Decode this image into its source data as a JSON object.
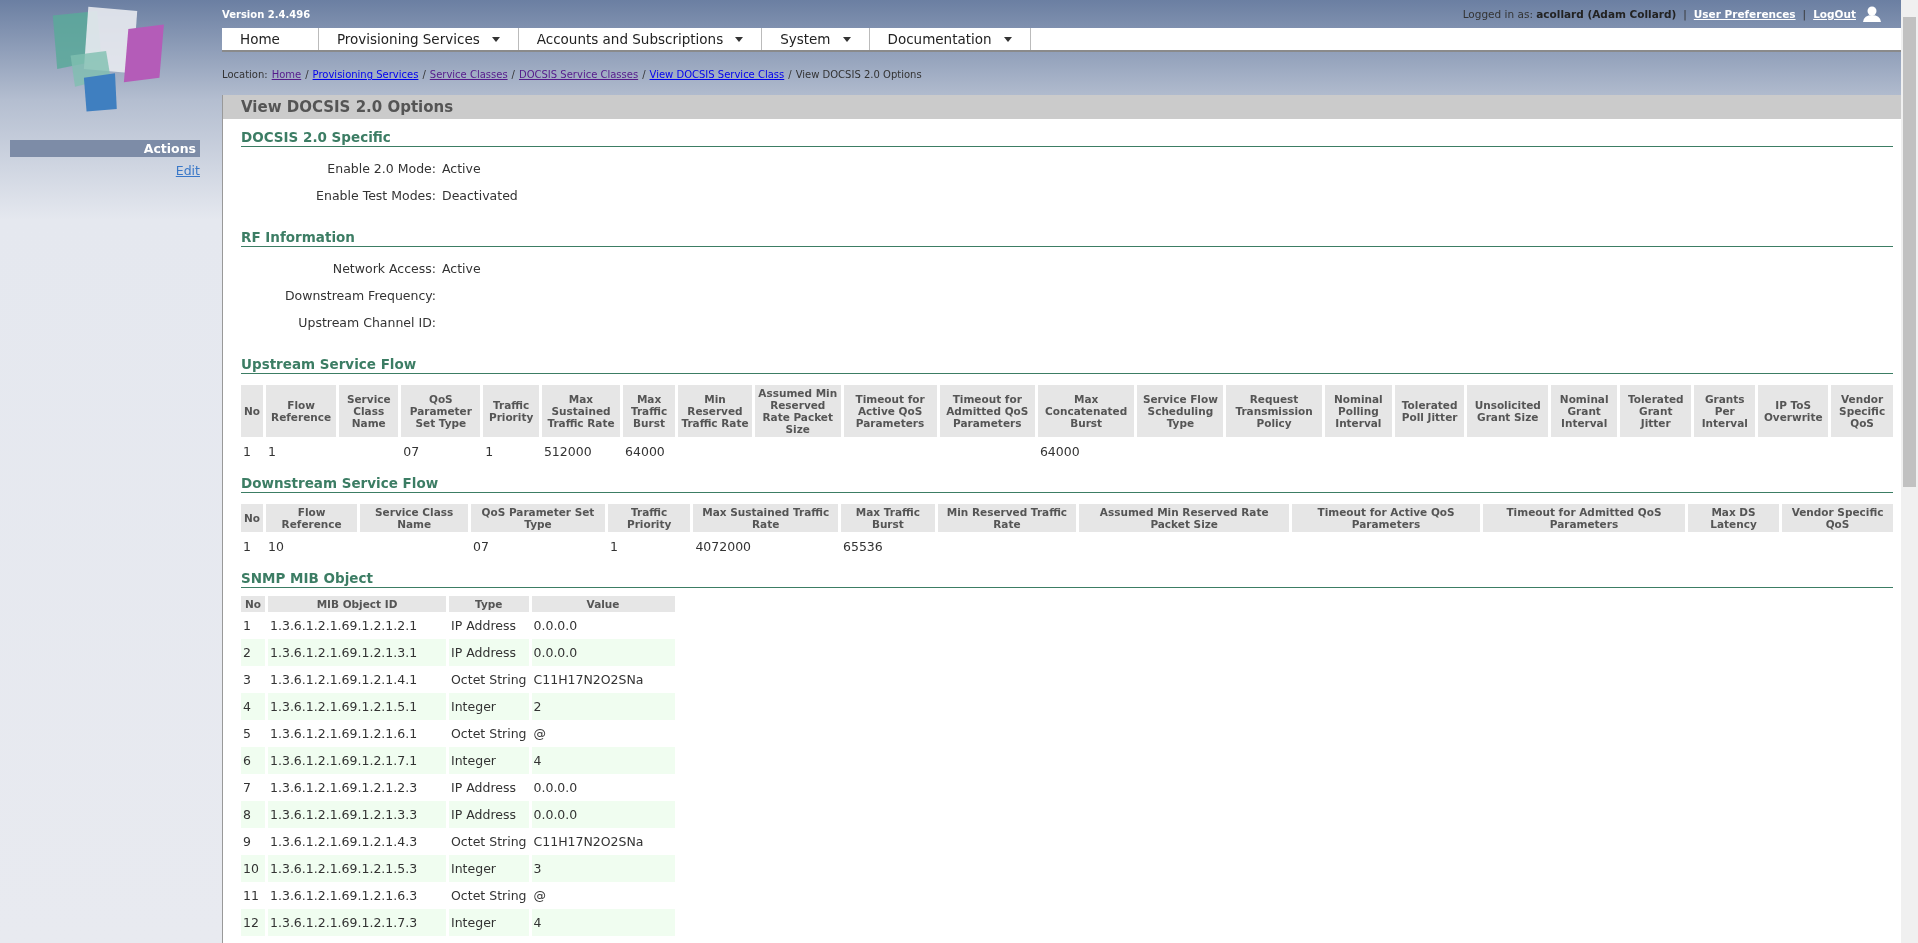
{
  "version": "Version 2.4.496",
  "user": {
    "prefix": "Logged in as:",
    "name": "acollard (Adam Collard)",
    "links": [
      "User Preferences",
      "LogOut"
    ],
    "separator": "|"
  },
  "nav": [
    {
      "label": "Home",
      "dropdown": false
    },
    {
      "label": "Provisioning Services",
      "dropdown": true
    },
    {
      "label": "Accounts and Subscriptions",
      "dropdown": true
    },
    {
      "label": "System",
      "dropdown": true
    },
    {
      "label": "Documentation",
      "dropdown": true
    }
  ],
  "breadcrumb": {
    "label": "Location:",
    "links": [
      {
        "label": "Home",
        "visited": true
      },
      {
        "label": "Provisioning Services",
        "visited": false
      },
      {
        "label": "Service Classes",
        "visited": true
      },
      {
        "label": "DOCSIS Service Classes",
        "visited": true
      },
      {
        "label": "View DOCSIS Service Class",
        "visited": false
      }
    ],
    "current": "View DOCSIS 2.0 Options",
    "separator": "/"
  },
  "sidebar": {
    "title": "Actions",
    "links": [
      "Edit"
    ]
  },
  "page_title": "View DOCSIS 2.0 Options",
  "sections": [
    {
      "title": "DOCSIS 2.0 Specific",
      "kind": "fields",
      "fields": [
        {
          "label": "Enable 2.0 Mode:",
          "value": "Active"
        },
        {
          "label": "Enable Test Modes:",
          "value": "Deactivated"
        }
      ]
    },
    {
      "title": "RF Information",
      "kind": "fields",
      "fields": [
        {
          "label": "Network Access:",
          "value": "Active"
        },
        {
          "label": "Downstream Frequency:"
        },
        {
          "label": "Upstream Channel ID:"
        }
      ]
    },
    {
      "title": "Upstream Service Flow",
      "kind": "table",
      "columns": [
        "No",
        "Flow Reference",
        "Service Class Name",
        "QoS Parameter Set Type",
        "Traffic Priority",
        "Max Sustained Traffic Rate",
        "Max Traffic Burst",
        "Min Reserved Traffic Rate",
        "Assumed Min Reserved Rate Packet Size",
        "Timeout for Active QoS Parameters",
        "Timeout for Admitted QoS Parameters",
        "Max Concatenated Burst",
        "Service Flow Scheduling Type",
        "Request Transmission Policy",
        "Nominal Polling Interval",
        "Tolerated Poll Jitter",
        "Unsolicited Grant Size",
        "Nominal Grant Interval",
        "Tolerated Grant Jitter",
        "Grants Per Interval",
        "IP ToS Overwrite",
        "Vendor Specific QoS"
      ],
      "rows": [
        [
          "1",
          "1",
          null,
          "07",
          "1",
          "512000",
          "64000",
          null,
          null,
          null,
          null,
          "64000",
          null,
          null,
          null,
          null,
          null,
          null,
          null,
          null,
          null,
          null
        ]
      ]
    },
    {
      "title": "Downstream Service Flow",
      "kind": "table",
      "columns": [
        "No",
        "Flow Reference",
        "Service Class Name",
        "QoS Parameter Set Type",
        "Traffic Priority",
        "Max Sustained Traffic Rate",
        "Max Traffic Burst",
        "Min Reserved Traffic Rate",
        "Assumed Min Reserved Rate Packet Size",
        "Timeout for Active QoS Parameters",
        "Timeout for Admitted QoS Parameters",
        "Max DS Latency",
        "Vendor Specific QoS"
      ],
      "rows": [
        [
          "1",
          "10",
          null,
          "07",
          "1",
          "4072000",
          "65536",
          null,
          null,
          null,
          null,
          null,
          null
        ]
      ]
    },
    {
      "title": "SNMP MIB Object",
      "kind": "striped_table",
      "columns": [
        "No",
        "MIB Object ID",
        "Type",
        "Value"
      ],
      "rows": [
        [
          "1",
          "1.3.6.1.2.1.69.1.2.1.2.1",
          "IP Address",
          "0.0.0.0"
        ],
        [
          "2",
          "1.3.6.1.2.1.69.1.2.1.3.1",
          "IP Address",
          "0.0.0.0"
        ],
        [
          "3",
          "1.3.6.1.2.1.69.1.2.1.4.1",
          "Octet String",
          "C11H17N2O2SNa"
        ],
        [
          "4",
          "1.3.6.1.2.1.69.1.2.1.5.1",
          "Integer",
          "2"
        ],
        [
          "5",
          "1.3.6.1.2.1.69.1.2.1.6.1",
          "Octet String",
          "@"
        ],
        [
          "6",
          "1.3.6.1.2.1.69.1.2.1.7.1",
          "Integer",
          "4"
        ],
        [
          "7",
          "1.3.6.1.2.1.69.1.2.1.2.3",
          "IP Address",
          "0.0.0.0"
        ],
        [
          "8",
          "1.3.6.1.2.1.69.1.2.1.3.3",
          "IP Address",
          "0.0.0.0"
        ],
        [
          "9",
          "1.3.6.1.2.1.69.1.2.1.4.3",
          "Octet String",
          "C11H17N2O2SNa"
        ],
        [
          "10",
          "1.3.6.1.2.1.69.1.2.1.5.3",
          "Integer",
          "3"
        ],
        [
          "11",
          "1.3.6.1.2.1.69.1.2.1.6.3",
          "Octet String",
          "@"
        ],
        [
          "12",
          "1.3.6.1.2.1.69.1.2.1.7.3",
          "Integer",
          "4"
        ]
      ]
    }
  ]
}
